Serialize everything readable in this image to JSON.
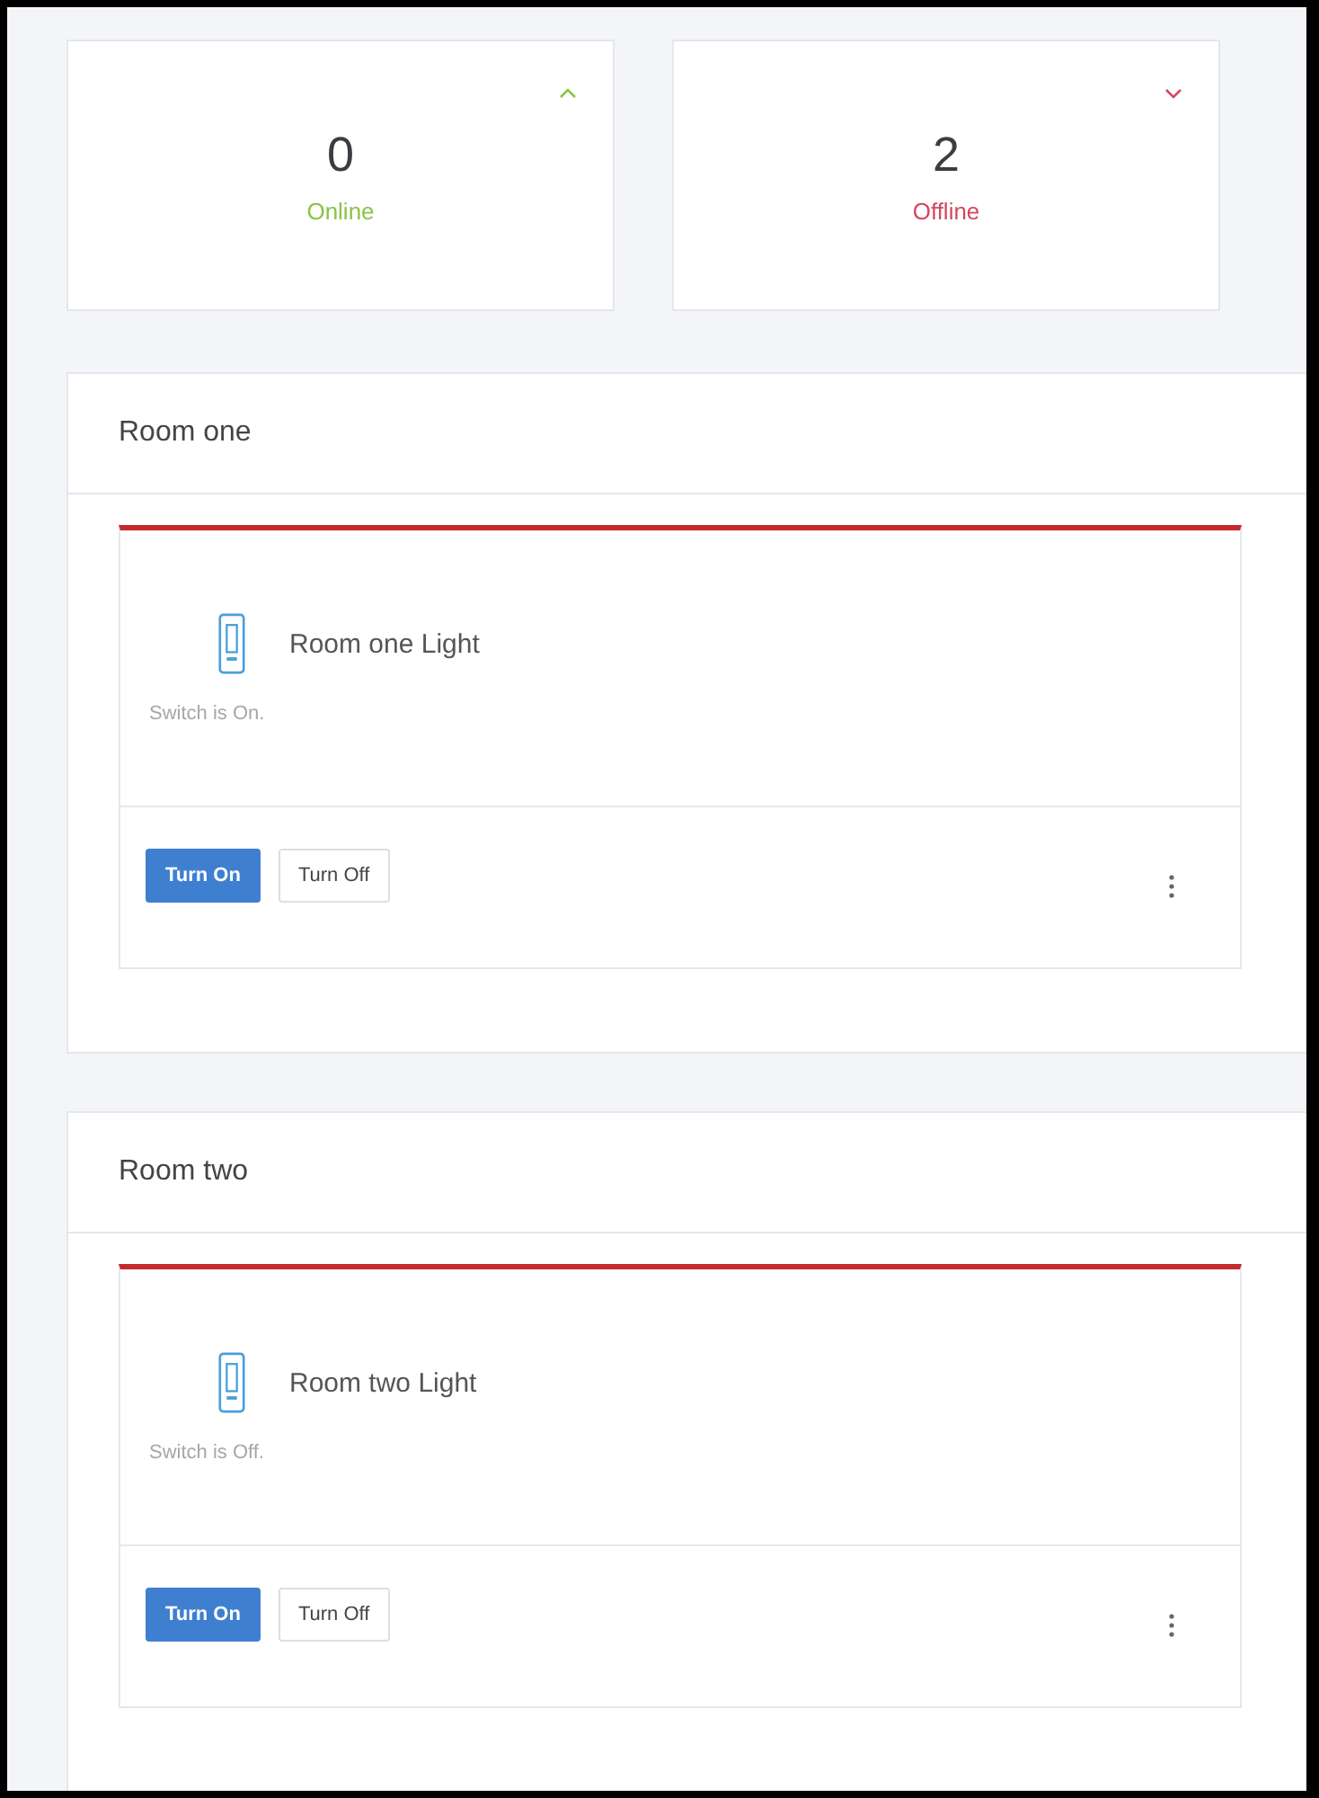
{
  "stats": [
    {
      "value": "0",
      "label": "Online",
      "rising": true
    },
    {
      "value": "2",
      "label": "Offline",
      "rising": false
    }
  ],
  "rooms": [
    {
      "title": "Room one",
      "devices": [
        {
          "name": "Room one Light",
          "status": "Switch is On.",
          "online": false,
          "buttons": [
            {
              "label": "Turn On",
              "kind": "primary"
            },
            {
              "label": "Turn Off",
              "kind": "default"
            }
          ]
        }
      ]
    },
    {
      "title": "Room two",
      "devices": [
        {
          "name": "Room two Light",
          "status": "Switch is Off.",
          "online": false,
          "buttons": [
            {
              "label": "Turn On",
              "kind": "primary"
            },
            {
              "label": "Turn Off",
              "kind": "default"
            }
          ]
        }
      ]
    }
  ]
}
